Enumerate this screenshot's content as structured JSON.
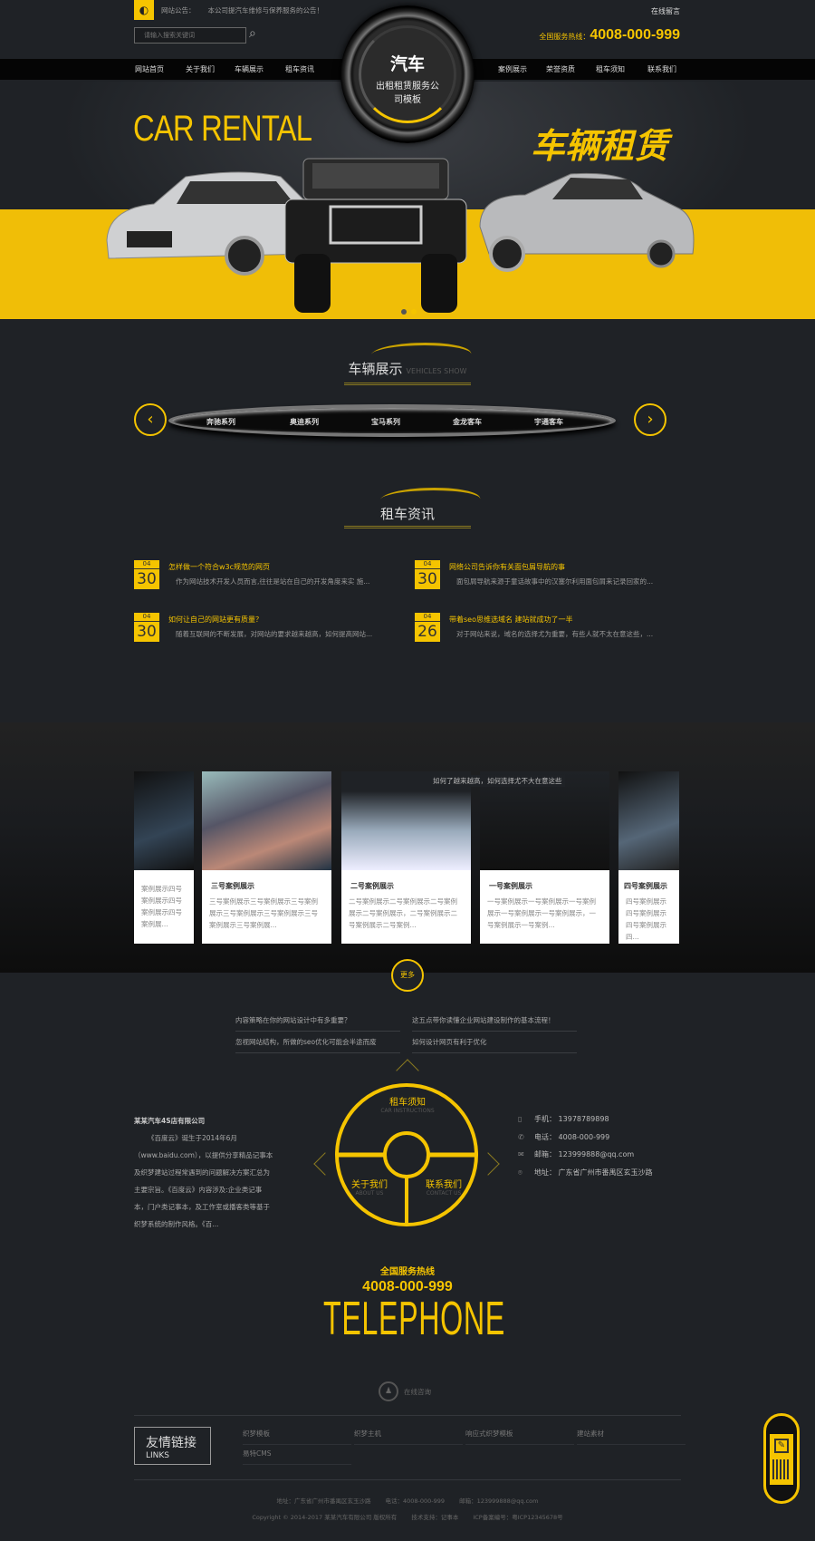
{
  "header": {
    "notice_label": "网站公告：",
    "notice_text": "本公司提汽车维修与保养服务的公告！",
    "search_placeholder": "请输入搜索关键词",
    "online_message": "在线留言",
    "hotline_label": "全国服务热线：",
    "hotline_number": "4008-000-999"
  },
  "logo": {
    "title": "汽车",
    "subtitle": "出租租赁服务公司模板"
  },
  "nav": {
    "left": [
      "网站首页",
      "关于我们",
      "车辆展示",
      "租车资讯"
    ],
    "right": [
      "案例展示",
      "荣誉资质",
      "租车须知",
      "联系我们"
    ]
  },
  "banner": {
    "en_title": "CAR RENTAL",
    "cn_title": "车辆租赁",
    "slide_count": 2,
    "active_slide": 2
  },
  "colors": {
    "accent": "#f5c400",
    "background": "#1f2226"
  },
  "vehicles": {
    "title": "车辆展示",
    "subtitle": "VEHICLES SHOW",
    "categories": [
      "奔驰系列",
      "奥迪系列",
      "宝马系列",
      "金龙客车",
      "宇通客车"
    ]
  },
  "news": {
    "title": "租车资讯",
    "items": [
      {
        "month": "04",
        "day": "30",
        "title": "怎样做一个符合w3c规范的网页",
        "desc": "作为网站技术开发人员而言,往往是站在自己的开发角度来实 施..."
      },
      {
        "month": "04",
        "day": "30",
        "title": "网络公司告诉你有关面包屑导航的事",
        "desc": "面包屑导航来源于童话故事中的汉塞尔利用面包屑来记录回家的..."
      },
      {
        "month": "04",
        "day": "30",
        "title": "如何让自己的网站更有质量？",
        "desc": "随着互联网的不断发展，对网站的要求越来越高，如何提高网站..."
      },
      {
        "month": "04",
        "day": "26",
        "title": "带着seo思维选域名 建站就成功了一半",
        "desc": "对于网站来说，域名的选择尤为重要，有些人就不太在意这些，..."
      }
    ]
  },
  "cases": {
    "blurb": "如何了越来越高，如何选择尤不大在意这些",
    "items": [
      {
        "title": "",
        "desc": "案例展示四号案例展示四号案例展示四号案例展..."
      },
      {
        "title": "三号案例展示",
        "desc": "三号案例展示三号案例展示三号案例展示三号案例展示三号案例展示三号案例展示三号案例展..."
      },
      {
        "title": "二号案例展示",
        "desc": "二号案例展示二号案例展示二号案例展示二号案例展示，二号案例展示二号案例展示二号案例..."
      },
      {
        "title": "一号案例展示",
        "desc": "一号案例展示一号案例展示一号案例展示一号案例展示一号案例展示，一号案例展示一号案例..."
      },
      {
        "title": "四号案例展示",
        "desc": "四号案例展示四号案例展示四号案例展示四..."
      }
    ],
    "more": "更多"
  },
  "links": [
    "内容策略在你的网站设计中有多重要？",
    "这五点带你读懂企业网站建设制作的基本流程！",
    "忽视网站结构，所做的seo优化可能会半途而废",
    "如何设计网页有利于优化"
  ],
  "wheel": {
    "top": "租车须知",
    "top_en": "CAR INSTRUCTIONS",
    "left": "关于我们",
    "left_en": "ABOUT US",
    "right": "联系我们",
    "right_en": "CONTACT US"
  },
  "company": {
    "name": "某某汽车4S店有限公司",
    "text": "《百度云》诞生于2014年6月（www.baidu.com），以提供分享精品记事本及织梦建站过程常遇到的问题解决方案汇总为主要宗旨。《百度云》内容涉及:企业类记事本，门户类记事本，及工作室或播客类等基于织梦系统的制作风格。《百..."
  },
  "contact": [
    {
      "icon": "mobile-icon",
      "label": "手机：",
      "value": "13978789898"
    },
    {
      "icon": "phone-icon",
      "label": "电话：",
      "value": "4008-000-999"
    },
    {
      "icon": "mail-icon",
      "label": "邮箱：",
      "value": "123999888@qq.com"
    },
    {
      "icon": "location-icon",
      "label": "地址：",
      "value": "广东省广州市番禺区玄玉沙路"
    }
  ],
  "telephone": {
    "label": "全国服务热线",
    "number": "4008-000-999",
    "big": "TELEPHONE"
  },
  "qq": {
    "label": "在线咨询"
  },
  "friend_links": {
    "title": "友情链接",
    "title_en": "LINKS",
    "items": [
      "织梦模板",
      "织梦主机",
      "响应式织梦模板",
      "建站素材",
      "易特CMS"
    ]
  },
  "footer": {
    "address": "地址：广东省广州市番禺区玄玉沙路",
    "phone": "电话：4008-000-999",
    "email": "邮箱：123999888@qq.com",
    "copyright": "Copyright © 2014-2017 某某汽车有限公司 版权所有",
    "support": "技术支持：记事本",
    "icp": "ICP备案编号：粤ICP12345678号"
  }
}
